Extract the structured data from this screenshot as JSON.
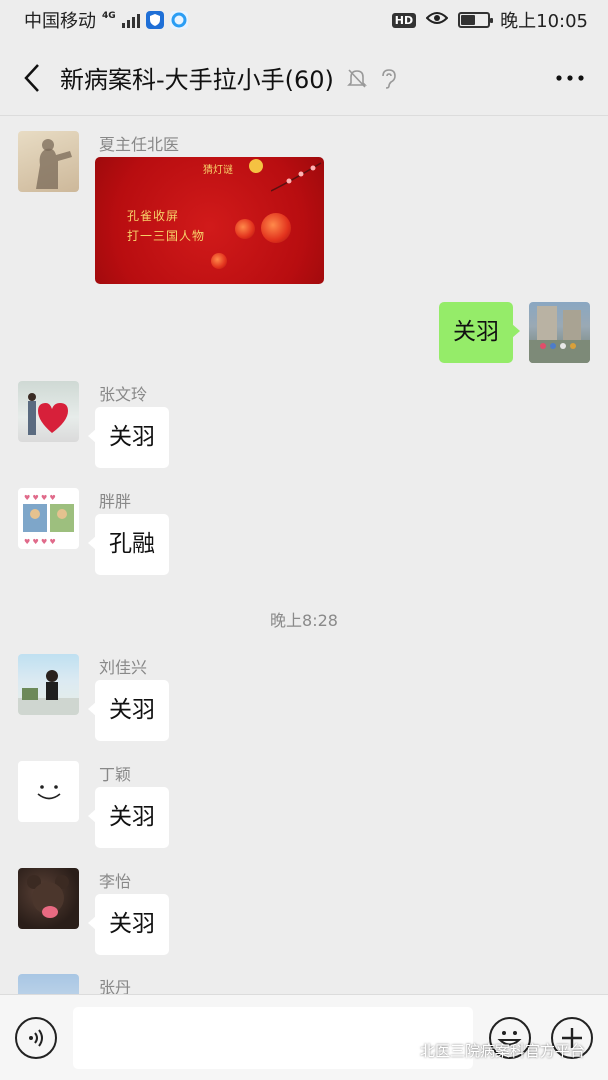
{
  "status_bar": {
    "carrier": "中国移动",
    "network": "4G",
    "hd": "HD",
    "time": "晚上10:05",
    "battery_level": 0.55
  },
  "header": {
    "title": "新病案科-大手拉小手(60)",
    "icons": [
      "back-arrow-icon",
      "mute-bell-icon",
      "earpiece-icon",
      "more-icon"
    ]
  },
  "messages": [
    {
      "side": "left",
      "sender": "夏主任北医",
      "type": "image",
      "image": {
        "tag": "猜灯谜",
        "line1": "孔雀收屏",
        "line2": "打一三国人物"
      }
    },
    {
      "side": "right",
      "sender": "",
      "type": "text",
      "text": "关羽"
    },
    {
      "side": "left",
      "sender": "张文玲",
      "type": "text",
      "text": "关羽"
    },
    {
      "side": "left",
      "sender": "胖胖",
      "type": "text",
      "text": "孔融"
    },
    {
      "type": "time",
      "text": "晚上8:28"
    },
    {
      "side": "left",
      "sender": "刘佳兴",
      "type": "text",
      "text": "关羽"
    },
    {
      "side": "left",
      "sender": "丁颖",
      "type": "text",
      "text": "关羽"
    },
    {
      "side": "left",
      "sender": "李怡",
      "type": "text",
      "text": "关羽"
    },
    {
      "side": "left",
      "sender": "张丹",
      "type": "text",
      "text": ""
    }
  ],
  "input_bar": {
    "placeholder": "",
    "icons": [
      "voice-icon",
      "emoji-icon",
      "plus-icon"
    ]
  },
  "watermark": "北医三院病案科官方平台",
  "colors": {
    "self_bubble": "#95ec69",
    "other_bubble": "#ffffff",
    "background": "#ededed",
    "riddle_card": "#c8131a"
  }
}
